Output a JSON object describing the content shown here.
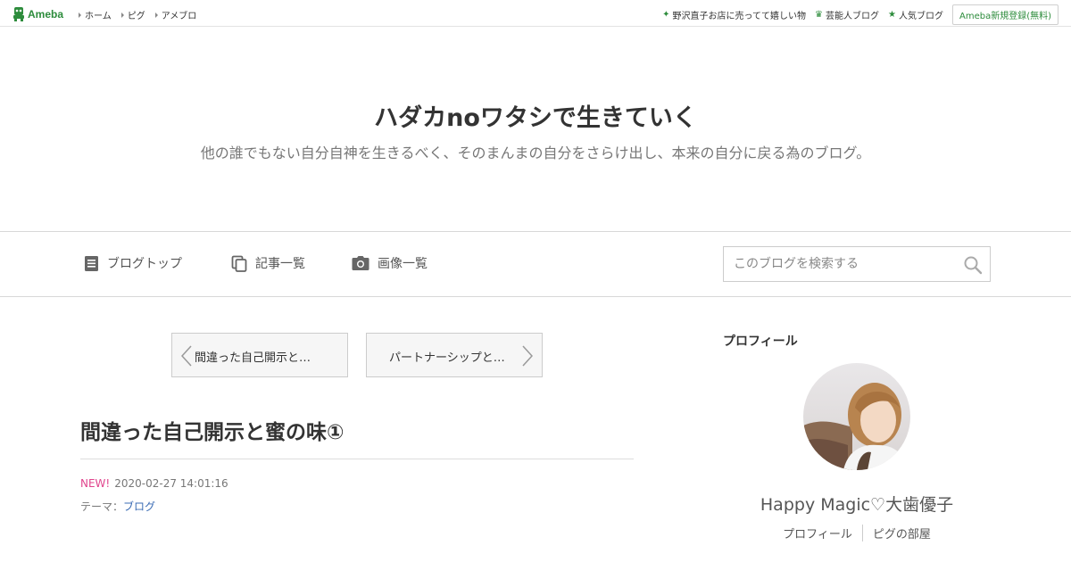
{
  "global_header": {
    "logo_text": "Ameba",
    "nav": [
      {
        "label": "ホーム"
      },
      {
        "label": "ピグ"
      },
      {
        "label": "アメブロ"
      }
    ],
    "right_links": [
      {
        "label": "野沢直子お店に売ってて嬉しい物",
        "icon": "sparkle-icon"
      },
      {
        "label": "芸能人ブログ",
        "icon": "crown-icon"
      },
      {
        "label": "人気ブログ",
        "icon": "star-icon"
      }
    ],
    "signup_label": "Ameba新規登録(無料)"
  },
  "blog": {
    "title": "ハダカnoワタシで生きていく",
    "description": "他の誰でもない自分自神を生きるべく、そのまんまの自分をさらけ出し、本来の自分に戻る為のブログ。"
  },
  "blog_nav": {
    "items": [
      {
        "label": "ブログトップ",
        "icon": "document-icon"
      },
      {
        "label": "記事一覧",
        "icon": "copy-icon"
      },
      {
        "label": "画像一覧",
        "icon": "camera-icon"
      }
    ],
    "search_placeholder": "このブログを検索する"
  },
  "pager": {
    "prev_label": "間違った自己開示と…",
    "next_label": "パートナーシップと…"
  },
  "article": {
    "title": "間違った自己開示と蜜の味①",
    "new_badge": "NEW!",
    "datetime": "2020-02-27 14:01:16",
    "theme_label": "テーマ：",
    "theme_value": "ブログ"
  },
  "sidebar": {
    "heading": "プロフィール",
    "profile_name": "Happy Magic♡大歯優子",
    "links": [
      {
        "label": "プロフィール"
      },
      {
        "label": "ピグの部屋"
      }
    ]
  },
  "colors": {
    "ameba_green": "#2d8c3c",
    "new_badge": "#e0458d",
    "link_blue": "#3a6bb4"
  }
}
